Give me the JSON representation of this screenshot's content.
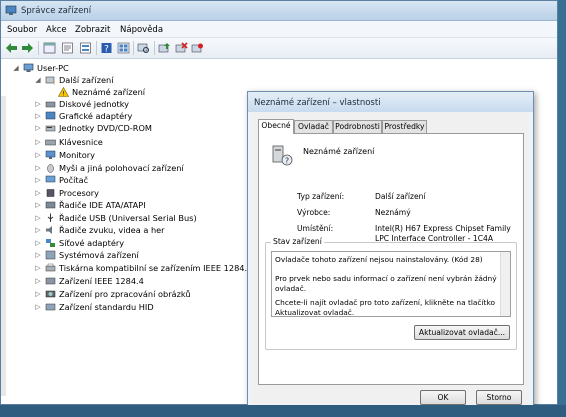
{
  "window": {
    "title": "Správce zařízení"
  },
  "menu": [
    "Soubor",
    "Akce",
    "Zobrazit",
    "Nápověda"
  ],
  "tree": {
    "root": "User-PC",
    "items": [
      {
        "label": "Další zařízení",
        "expanded": true
      },
      {
        "label": "Neznámé zařízení",
        "child": true
      },
      {
        "label": "Diskové jednotky"
      },
      {
        "label": "Grafické adaptéry"
      },
      {
        "label": "Jednotky DVD/CD-ROM"
      },
      {
        "label": "Klávesnice"
      },
      {
        "label": "Monitory"
      },
      {
        "label": "Myši a jiná polohovací zařízení"
      },
      {
        "label": "Počítač"
      },
      {
        "label": "Procesory"
      },
      {
        "label": "Řadiče IDE ATA/ATAPI"
      },
      {
        "label": "Řadiče USB (Universal Serial Bus)"
      },
      {
        "label": "Řadiče zvuku, videa a her"
      },
      {
        "label": "Síťové adaptéry"
      },
      {
        "label": "Systémová zařízení"
      },
      {
        "label": "Tiskárna kompatibilní se zařízením IEEE 1284.4"
      },
      {
        "label": "Zařízení IEEE 1284.4"
      },
      {
        "label": "Zařízení pro zpracování obrázků"
      },
      {
        "label": "Zařízení standardu HID"
      }
    ]
  },
  "dialog": {
    "title": "Neznámé zařízení – vlastnosti",
    "tabs": [
      "Obecné",
      "Ovladač",
      "Podrobnosti",
      "Prostředky"
    ],
    "device_name": "Neznámé zařízení",
    "props": [
      {
        "label": "Typ zařízení:",
        "value": "Další zařízení"
      },
      {
        "label": "Výrobce:",
        "value": "Neznámý"
      },
      {
        "label": "Umístění:",
        "value": "Intel(R) H67 Express Chipset Family LPC Interface Controller - 1C4A"
      }
    ],
    "status_title": "Stav zařízení",
    "status_lines": [
      "Ovladače tohoto zařízení nejsou nainstalovány. (Kód 28)",
      "Pro prvek nebo sadu informací o zařízení není vybrán žádný ovladač.",
      "Chcete-li najít ovladač pro toto zařízení, klikněte na tlačítko Aktualizovat ovladač."
    ],
    "update_button": "Aktualizovat ovladač...",
    "ok_button": "OK",
    "cancel_button": "Storno"
  },
  "colors": {
    "accent": "#3a6f94",
    "title_bar": "#c8dbee"
  }
}
